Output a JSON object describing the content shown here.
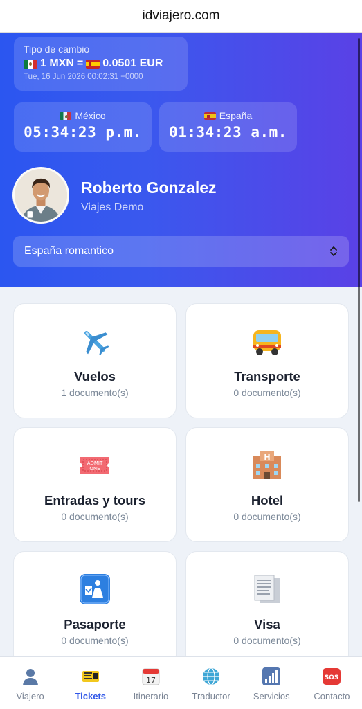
{
  "browser": {
    "url": "idviajero.com"
  },
  "exchange": {
    "label": "Tipo de cambio",
    "rate": "1 MXN = 🇪🇸 0.0501 EUR",
    "from": "1 MXN",
    "equals": "=",
    "to": "0.0501 EUR",
    "timestamp": "Tue, 16 Jun 2026 00:02:31 +0000"
  },
  "clocks": [
    {
      "country": "México",
      "time": "05:34:23 p.m."
    },
    {
      "country": "España",
      "time": "01:34:23 a.m."
    }
  ],
  "user": {
    "name": "Roberto Gonzalez",
    "company": "Viajes Demo"
  },
  "trip_select": {
    "value": "España romantico"
  },
  "cards": [
    {
      "title": "Vuelos",
      "count": "1 documento(s)",
      "icon": "airplane-icon"
    },
    {
      "title": "Transporte",
      "count": "0 documento(s)",
      "icon": "bus-icon"
    },
    {
      "title": "Entradas y tours",
      "count": "0 documento(s)",
      "icon": "ticket-icon"
    },
    {
      "title": "Hotel",
      "count": "0 documento(s)",
      "icon": "hotel-icon"
    },
    {
      "title": "Pasaporte",
      "count": "0 documento(s)",
      "icon": "passport-control-icon"
    },
    {
      "title": "Visa",
      "count": "0 documento(s)",
      "icon": "documents-icon"
    }
  ],
  "tabs": [
    {
      "label": "Viajero",
      "icon": "person-icon",
      "active": false
    },
    {
      "label": "Tickets",
      "icon": "ticket-icon",
      "active": true
    },
    {
      "label": "Itinerario",
      "icon": "calendar-icon",
      "active": false
    },
    {
      "label": "Traductor",
      "icon": "globe-icon",
      "active": false
    },
    {
      "label": "Servicios",
      "icon": "chart-icon",
      "active": false
    },
    {
      "label": "Contacto",
      "icon": "sos-icon",
      "active": false
    }
  ],
  "colors": {
    "accent": "#2f56e8",
    "hero_start": "#2b56f0",
    "hero_end": "#5a41e6"
  }
}
